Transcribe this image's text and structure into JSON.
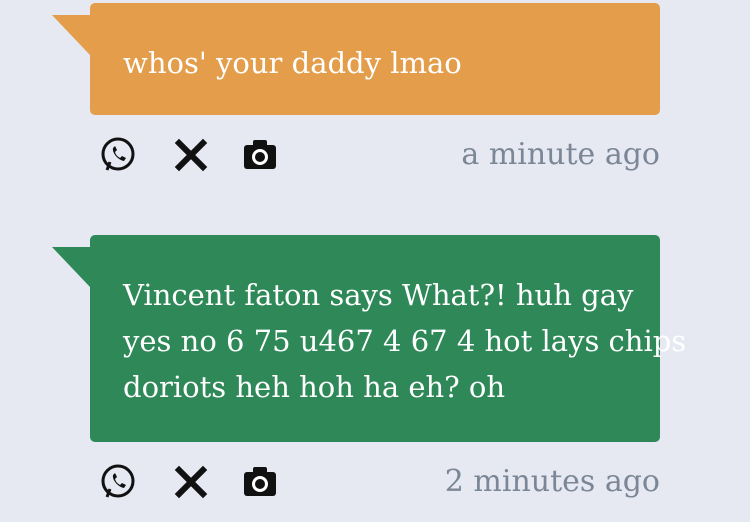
{
  "messages": [
    {
      "text_lines": [
        "whos' your daddy lmao"
      ],
      "timestamp": "a minute ago",
      "color": "#e39d4b",
      "actions": [
        "whatsapp-icon",
        "x-icon",
        "camera-icon"
      ]
    },
    {
      "text_lines": [
        "Vincent faton says What?! huh gay",
        "yes no 6 75 u467 4 67 4 hot lays chips",
        "doriots heh hoh ha eh? oh"
      ],
      "timestamp": "2 minutes ago",
      "color": "#2e8857",
      "actions": [
        "whatsapp-icon",
        "x-icon",
        "camera-icon"
      ]
    }
  ],
  "theme": {
    "background": "#e6e9f2",
    "icon_color": "#111111",
    "timestamp_color": "#7b8796"
  }
}
